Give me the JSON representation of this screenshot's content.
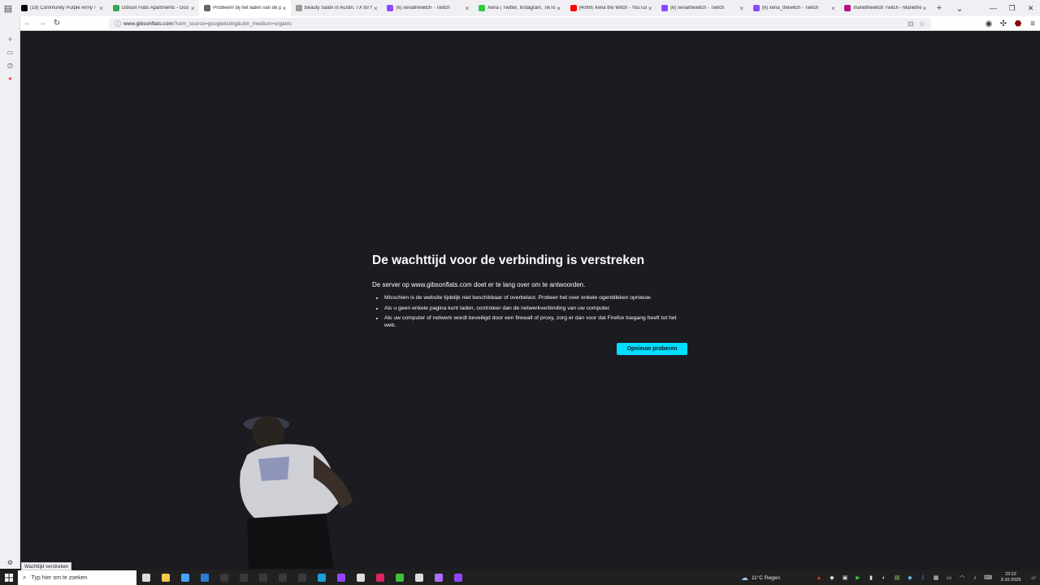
{
  "tabs": [
    {
      "title": "(18) Community Purple Army /",
      "color": "#000000",
      "icon": "x-logo-icon",
      "active": false
    },
    {
      "title": "Gibson Flats Apartments - Goo",
      "color": "#34a853",
      "icon": "map-pin-icon",
      "active": false
    },
    {
      "title": "Probleem bij het laden van de p",
      "color": "#666666",
      "icon": "info-icon",
      "active": true
    },
    {
      "title": "Beauty Salon in Austin, TX for N",
      "color": "#999999",
      "icon": "page-icon",
      "active": false
    },
    {
      "title": "(6) xenathewitch - Twitch",
      "color": "#9146ff",
      "icon": "twitch-icon",
      "active": false
    },
    {
      "title": "Xena | Twitter, Instagram, TikTo",
      "color": "#2ecc40",
      "icon": "linktree-icon",
      "active": false
    },
    {
      "title": "(4099) Xena the Witch - YouTub",
      "color": "#ff0000",
      "icon": "youtube-icon",
      "active": false
    },
    {
      "title": "(6) xenathewitch - Twitch",
      "color": "#9146ff",
      "icon": "twitch-icon",
      "active": false
    },
    {
      "title": "(6) xena_thewitch - Twitch",
      "color": "#9146ff",
      "icon": "twitch-icon",
      "active": false
    },
    {
      "title": "mariethewitch Twitch - Mariethe",
      "color": "#b5177a",
      "icon": "twitch-icon",
      "active": false
    }
  ],
  "window": {
    "close_tab": "×",
    "new_tab": "+",
    "list_tabs": "⌄",
    "minimize": "—",
    "restore": "❐",
    "close": "✕"
  },
  "urlbar": {
    "domain": "www.gibsonflats.com",
    "path": "/?utm_source=googlelisting&utm_medium=organic"
  },
  "error": {
    "title": "De wachttijd voor de verbinding is verstreken",
    "lead": "De server op www.gibsonflats.com doet er te lang over om te antwoorden.",
    "bullets": [
      "Misschien is de website tijdelijk niet beschikbaar of overbelast. Probeer het over enkele ogenblikken opnieuw.",
      "Als u geen enkele pagina kunt laden, controleer dan de netwerkverbinding van uw computer.",
      "Als uw computer of netwerk wordt beveiligd door een firewall of proxy, zorg er dan voor dat Firefox toegang heeft tot het web."
    ],
    "retry_label": "Opnieuw proberen",
    "accent": "#00ddff"
  },
  "status_text": "Wachttijd verstreken",
  "taskbar": {
    "search_placeholder": "Typ hier om te zoeken",
    "weather": "11°C  Regen",
    "time": "23:22",
    "date": "3-10-2025",
    "apps": [
      {
        "icon": "task-view-icon",
        "color": "#dddddd"
      },
      {
        "icon": "file-explorer-icon",
        "color": "#f2c94c"
      },
      {
        "icon": "store-icon",
        "color": "#4aa3ff"
      },
      {
        "icon": "outlook-icon",
        "color": "#2d7dd2"
      },
      {
        "icon": "app-icon",
        "color": "#3a3a3a"
      },
      {
        "icon": "app-icon",
        "color": "#3a3a3a"
      },
      {
        "icon": "app-icon",
        "color": "#3a3a3a"
      },
      {
        "icon": "app-icon",
        "color": "#3a3a3a"
      },
      {
        "icon": "app-icon",
        "color": "#3a3a3a"
      },
      {
        "icon": "edge-icon",
        "color": "#1a9fd9"
      },
      {
        "icon": "twitch-icon",
        "color": "#9146ff"
      },
      {
        "icon": "obs-icon",
        "color": "#dddddd"
      },
      {
        "icon": "app-icon",
        "color": "#e0245e"
      },
      {
        "icon": "play-icon",
        "color": "#3fbf3f"
      },
      {
        "icon": "ga-icon",
        "color": "#dddddd"
      },
      {
        "icon": "chat-icon",
        "color": "#a970ff"
      },
      {
        "icon": "app-icon",
        "color": "#9146ff"
      }
    ]
  }
}
